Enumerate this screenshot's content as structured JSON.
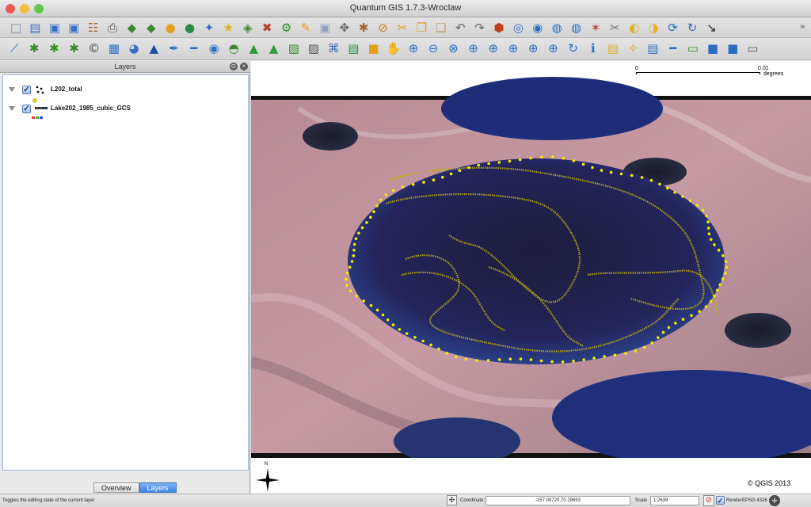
{
  "window": {
    "title": "Quantum GIS 1.7.3-Wroclaw"
  },
  "traffic_colors": {
    "close": "#ee5a52",
    "minimize": "#f4be3f",
    "zoom": "#5ec94a"
  },
  "toolbar_row1": [
    {
      "icon": "new-project-icon",
      "glyph": "□",
      "color": "#7a8fb0"
    },
    {
      "icon": "open-project-icon",
      "glyph": "▤",
      "color": "#3a6fc4"
    },
    {
      "icon": "save-project-icon",
      "glyph": "▣",
      "color": "#3a6fc4"
    },
    {
      "icon": "save-as-icon",
      "glyph": "▣",
      "color": "#3a6fc4"
    },
    {
      "icon": "print-composer-icon",
      "glyph": "☷",
      "color": "#9a6b2f"
    },
    {
      "icon": "print-icon",
      "glyph": "⎙",
      "color": "#555"
    },
    {
      "icon": "add-vector-icon",
      "glyph": "◆",
      "color": "#3c8a2f"
    },
    {
      "icon": "add-raster-icon",
      "glyph": "◆",
      "color": "#3c8a2f"
    },
    {
      "icon": "add-postgis-icon",
      "glyph": "●",
      "color": "#e0a020"
    },
    {
      "icon": "add-spatialite-icon",
      "glyph": "●",
      "color": "#2f8a4a"
    },
    {
      "icon": "add-wms-icon",
      "glyph": "✦",
      "color": "#3a6fc4"
    },
    {
      "icon": "add-wfs-icon",
      "glyph": "★",
      "color": "#e0b020"
    },
    {
      "icon": "new-layer-icon",
      "glyph": "◈",
      "color": "#3c8a2f"
    },
    {
      "icon": "remove-layer-icon",
      "glyph": "✖",
      "color": "#c03a2a"
    },
    {
      "icon": "python-console-icon",
      "glyph": "⚙",
      "color": "#3c8a2f"
    },
    {
      "icon": "pencil-edit-icon",
      "glyph": "✎",
      "color": "#e0a020"
    },
    {
      "icon": "save-edits-icon",
      "glyph": "▣",
      "color": "#8aa0c0"
    },
    {
      "icon": "move-feature-icon",
      "glyph": "✥",
      "color": "#666"
    },
    {
      "icon": "node-tool-icon",
      "glyph": "✱",
      "color": "#a06030"
    },
    {
      "icon": "delete-selected-icon",
      "glyph": "⊘",
      "color": "#d08020"
    },
    {
      "icon": "cut-features-icon",
      "glyph": "✂",
      "color": "#e0a020"
    },
    {
      "icon": "copy-features-icon",
      "glyph": "❐",
      "color": "#e0a020"
    },
    {
      "icon": "paste-features-icon",
      "glyph": "❑",
      "color": "#c0a060"
    },
    {
      "icon": "undo-icon",
      "glyph": "↶",
      "color": "#666"
    },
    {
      "icon": "redo-icon",
      "glyph": "↷",
      "color": "#666"
    },
    {
      "icon": "simplify-icon",
      "glyph": "⬢",
      "color": "#c04020"
    },
    {
      "icon": "add-ring-icon",
      "glyph": "◎",
      "color": "#2a6fc4"
    },
    {
      "icon": "add-part-icon",
      "glyph": "◉",
      "color": "#2a6fc4"
    },
    {
      "icon": "delete-ring-icon",
      "glyph": "◍",
      "color": "#2a6fc4"
    },
    {
      "icon": "delete-part-icon",
      "glyph": "◍",
      "color": "#2a6fc4"
    },
    {
      "icon": "reshape-icon",
      "glyph": "✶",
      "color": "#d04040"
    },
    {
      "icon": "split-features-icon",
      "glyph": "✂",
      "color": "#777"
    },
    {
      "icon": "merge-features-icon",
      "glyph": "◐",
      "color": "#e0b020"
    },
    {
      "icon": "merge-attributes-icon",
      "glyph": "◑",
      "color": "#e0b020"
    },
    {
      "icon": "rotate-symbol-icon",
      "glyph": "⟳",
      "color": "#2a6fc4"
    },
    {
      "icon": "help-contents-icon",
      "glyph": "↻",
      "color": "#2a6fc4"
    },
    {
      "icon": "whats-this-icon",
      "glyph": "↘",
      "color": "#222"
    }
  ],
  "toolbar_row2": [
    {
      "icon": "digitize-line-icon",
      "glyph": "⟋",
      "color": "#2a6fc4"
    },
    {
      "icon": "plugin-a-icon",
      "glyph": "✱",
      "color": "#3c8a2f"
    },
    {
      "icon": "plugin-b-icon",
      "glyph": "✱",
      "color": "#3c8a2f"
    },
    {
      "icon": "plugin-c-icon",
      "glyph": "✱",
      "color": "#3c8a2f"
    },
    {
      "icon": "copyright-label-icon",
      "glyph": "©",
      "color": "#444"
    },
    {
      "icon": "grid-plugin-icon",
      "glyph": "▦",
      "color": "#2a6fc4"
    },
    {
      "icon": "georeferencer-icon",
      "glyph": "◕",
      "color": "#3a6fc4"
    },
    {
      "icon": "north-arrow-icon",
      "glyph": "▲",
      "color": "#1a4fa4"
    },
    {
      "icon": "coordinate-capture-icon",
      "glyph": "✒",
      "color": "#2a6fc4"
    },
    {
      "icon": "scale-bar-icon",
      "glyph": "━",
      "color": "#2a6fc4"
    },
    {
      "icon": "gps-tools-icon",
      "glyph": "◉",
      "color": "#2a6fc4"
    },
    {
      "icon": "interpolation-icon",
      "glyph": "◓",
      "color": "#3c8a2f"
    },
    {
      "icon": "heatmap-icon",
      "glyph": "▲",
      "color": "#2f9a3a"
    },
    {
      "icon": "terrain-icon",
      "glyph": "▲",
      "color": "#2f9a3a"
    },
    {
      "icon": "contour-icon",
      "glyph": "▧",
      "color": "#3c8a2f"
    },
    {
      "icon": "raster-terrain-icon",
      "glyph": "▨",
      "color": "#555"
    },
    {
      "icon": "spatial-query-icon",
      "glyph": "⌘",
      "color": "#3a6fc4"
    },
    {
      "icon": "table-manager-icon",
      "glyph": "▤",
      "color": "#2f8a4a"
    },
    {
      "icon": "oracle-raster-icon",
      "glyph": "■",
      "color": "#e0a020"
    },
    {
      "icon": "pan-icon",
      "glyph": "✋",
      "color": "#555"
    },
    {
      "icon": "zoom-in-icon",
      "glyph": "⊕",
      "color": "#2a6fc4"
    },
    {
      "icon": "zoom-out-icon",
      "glyph": "⊖",
      "color": "#2a6fc4"
    },
    {
      "icon": "zoom-full-icon",
      "glyph": "⊗",
      "color": "#2a6fc4"
    },
    {
      "icon": "zoom-selection-icon",
      "glyph": "⊕",
      "color": "#2a6fc4"
    },
    {
      "icon": "zoom-layer-icon",
      "glyph": "⊕",
      "color": "#2a6fc4"
    },
    {
      "icon": "zoom-last-icon",
      "glyph": "⊕",
      "color": "#2a6fc4"
    },
    {
      "icon": "zoom-next-icon",
      "glyph": "⊕",
      "color": "#2a6fc4"
    },
    {
      "icon": "zoom-actual-icon",
      "glyph": "⊕",
      "color": "#2a6fc4"
    },
    {
      "icon": "refresh-icon",
      "glyph": "↻",
      "color": "#2a6fc4"
    },
    {
      "icon": "identify-icon",
      "glyph": "ℹ",
      "color": "#2a6fc4"
    },
    {
      "icon": "map-tips-icon",
      "glyph": "▤",
      "color": "#e0b020"
    },
    {
      "icon": "select-features-icon",
      "glyph": "✧",
      "color": "#e0a020"
    },
    {
      "icon": "attribute-table-icon",
      "glyph": "▤",
      "color": "#2a6fc4"
    },
    {
      "icon": "measure-icon",
      "glyph": "━",
      "color": "#2a6fc4"
    },
    {
      "icon": "annotation-icon",
      "glyph": "▭",
      "color": "#3c8a2f"
    },
    {
      "icon": "new-bookmark-icon",
      "glyph": "■",
      "color": "#2a6fc4"
    },
    {
      "icon": "show-bookmarks-icon",
      "glyph": "■",
      "color": "#2a6fc4"
    },
    {
      "icon": "text-annotation-icon",
      "glyph": "▭",
      "color": "#555"
    }
  ],
  "layers_panel": {
    "title": "Layers",
    "layers": [
      {
        "name": "L202_total",
        "checked": true,
        "symbol": "point-symbol-icon"
      },
      {
        "name": "Lake202_1985_cubic_GCS",
        "checked": true,
        "symbol": "raster-symbol-icon"
      }
    ],
    "tabs": [
      "Overview",
      "Layers"
    ],
    "active_tab": "Layers"
  },
  "map": {
    "scalebar": {
      "left_label": "0",
      "right_label": "0.01",
      "units": "degrees"
    },
    "north_label": "N",
    "copyright": "© QGIS 2013"
  },
  "status": {
    "hint": "Toggles the editing state of the current layer",
    "coordinate_label": "Coordinate:",
    "coordinate_value": "-157.00720,70.29653",
    "scale_label": "Scale",
    "scale_value": "1:2639",
    "render_label": "Render",
    "epsg": "EPSG:4326"
  }
}
